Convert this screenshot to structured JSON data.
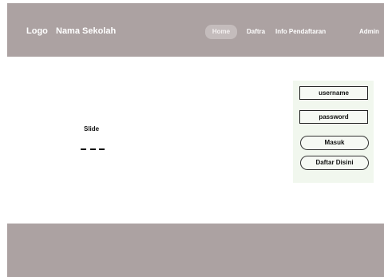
{
  "header": {
    "logo": "Logo",
    "school_name": "Nama Sekolah",
    "nav": [
      {
        "label": "Home",
        "active": true
      },
      {
        "label": "Daftra"
      },
      {
        "label": "Info Pendaftaran"
      },
      {
        "label": "Admin"
      }
    ]
  },
  "slide": {
    "label": "Slide",
    "indicator_count": 3
  },
  "login": {
    "username_placeholder": "username",
    "password_placeholder": "password",
    "submit_label": "Masuk",
    "register_label": "Daftar Disini"
  },
  "colors": {
    "header_footer_bg": "#aca2a2",
    "login_panel_bg": "#f1f7ee"
  }
}
